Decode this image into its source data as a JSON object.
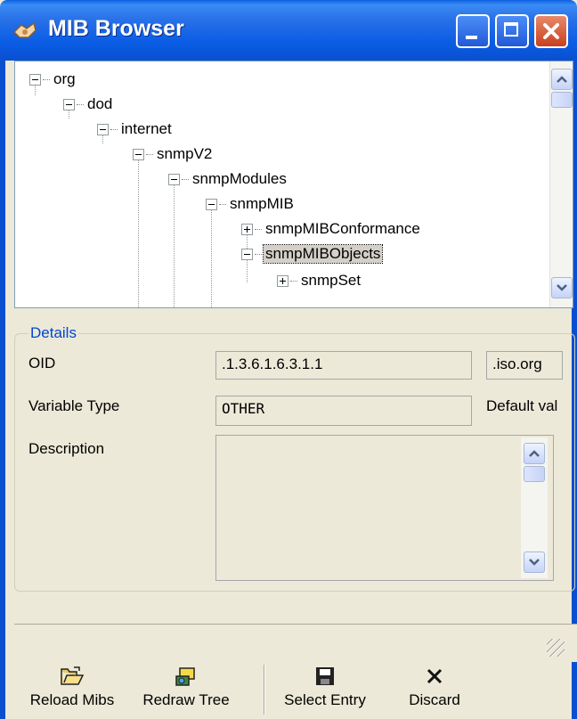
{
  "window": {
    "title": "MIB Browser",
    "icons": {
      "app": "mib-browser-app-icon",
      "minimize": "minimize-icon",
      "maximize": "maximize-icon",
      "close": "close-icon"
    }
  },
  "tree": {
    "nodes": [
      {
        "label": "org",
        "expander": "minus"
      },
      {
        "label": "dod",
        "expander": "minus"
      },
      {
        "label": "internet",
        "expander": "minus"
      },
      {
        "label": "snmpV2",
        "expander": "minus"
      },
      {
        "label": "snmpModules",
        "expander": "minus"
      },
      {
        "label": "snmpMIB",
        "expander": "minus"
      },
      {
        "label": "snmpMIBConformance",
        "expander": "plus"
      },
      {
        "label": "snmpMIBObjects",
        "expander": "minus",
        "selected": true
      },
      {
        "label": "snmpSet",
        "expander": "plus"
      }
    ]
  },
  "details": {
    "group_title": "Details",
    "oid_label": "OID",
    "oid_value": ".1.3.6.1.6.3.1.1",
    "oid_name": ".iso.org",
    "variable_type_label": "Variable Type",
    "variable_type_value": "OTHER",
    "default_value_label": "Default val",
    "description_label": "Description",
    "description_value": ""
  },
  "toolbar": {
    "reload_label": "Reload Mibs",
    "redraw_label": "Redraw Tree",
    "select_label": "Select Entry",
    "discard_label": "Discard"
  },
  "colors": {
    "titlebar": "#0a5de4",
    "group_title": "#0046d5",
    "window_bg": "#ece9d8"
  }
}
